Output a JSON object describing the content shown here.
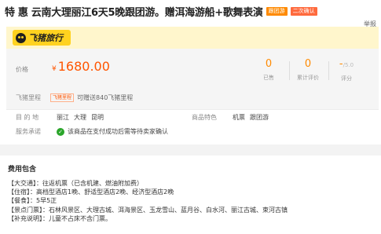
{
  "title": {
    "text": "特 惠 云南大理丽江6天5晚跟团游。赠洱海游船+歌舞表演",
    "tags": [
      "跟团游",
      "二次确认"
    ]
  },
  "report_label": "举报",
  "brand": {
    "logo_text": "飞猪旅行",
    "accent": "#ffd21f"
  },
  "price": {
    "label": "价格",
    "currency": "¥",
    "amount": "1680.00"
  },
  "stats": [
    {
      "value": "0",
      "label": "已售"
    },
    {
      "value": "0",
      "label": "累计评价"
    },
    {
      "value": "-",
      "suffix": "/5.0",
      "label": "评分"
    }
  ],
  "points": {
    "label": "飞猪里程",
    "tag": "飞猪里程",
    "text": "可赠送840飞猪里程"
  },
  "destination": {
    "label": "目 的 地",
    "values": [
      "丽江",
      "大理",
      "昆明"
    ]
  },
  "features": {
    "label": "商品特色",
    "values": [
      "机票",
      "跟团游"
    ]
  },
  "service": {
    "label": "服务承诺",
    "text": "该商品在支付成功后需等待卖家确认"
  },
  "cost": {
    "title": "费用包含",
    "lines": [
      "【大交通】：往返机票（已含机建、燃油附加费）",
      "【住宿】：高档型酒店1晚、舒适型酒店2晚、经济型酒店2晚",
      "【餐食】：5早5正",
      "【景点门票】：石林风景区、大理古城、洱海景区、玉龙雪山、蓝月谷、白水河、丽江古城、束河古镇",
      "【补充说明】：儿童不占床不含门票。"
    ]
  }
}
